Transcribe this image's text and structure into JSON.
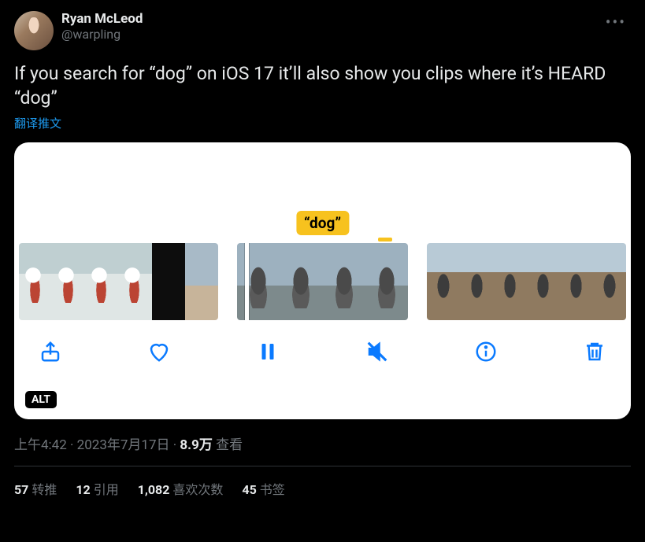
{
  "author": {
    "display_name": "Ryan McLeod",
    "handle": "@warpling"
  },
  "tweet_text": "If you search for “dog” on iOS 17 it’ll also show you clips where it’s HEARD “dog”",
  "translate_label": "翻译推文",
  "media": {
    "search_tag": "“dog”",
    "alt_badge": "ALT"
  },
  "meta": {
    "time": "上午4:42",
    "date": "2023年7月17日",
    "views_num": "8.9万",
    "views_label": "查看"
  },
  "stats": {
    "retweets_num": "57",
    "retweets_label": "转推",
    "quotes_num": "12",
    "quotes_label": "引用",
    "likes_num": "1,082",
    "likes_label": "喜欢次数",
    "bookmarks_num": "45",
    "bookmarks_label": "书签"
  }
}
